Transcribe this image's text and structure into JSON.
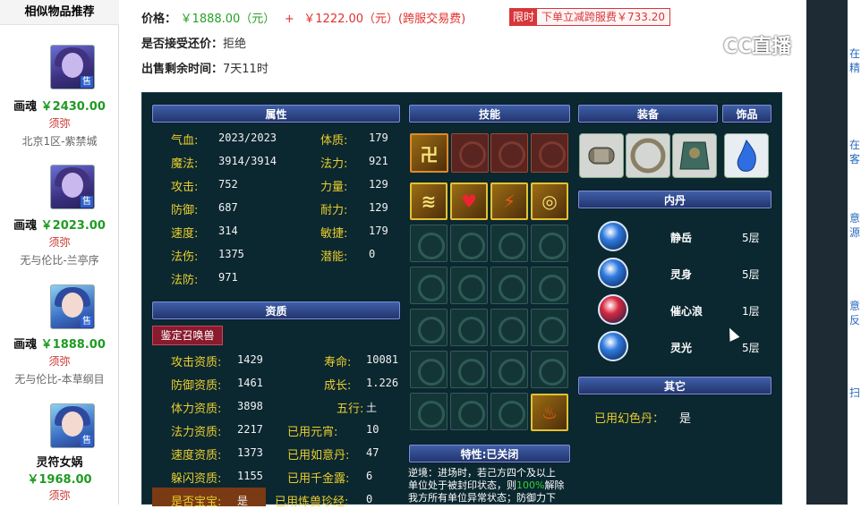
{
  "sidebar": {
    "title": "相似物品推荐",
    "items": [
      {
        "name": "画魂",
        "price": "￥2430.00",
        "server_tag": "须弥",
        "location": "北京1区-紫禁城",
        "sold_label": "售"
      },
      {
        "name": "画魂",
        "price": "￥2023.00",
        "server_tag": "须弥",
        "location": "无与伦比-兰亭序",
        "sold_label": "售"
      },
      {
        "name": "画魂",
        "price": "￥1888.00",
        "server_tag": "须弥",
        "location": "无与伦比-本草纲目",
        "sold_label": "售"
      },
      {
        "name": "灵符女娲",
        "price": "￥1968.00",
        "server_tag": "须弥",
        "location": "",
        "sold_label": "售"
      }
    ]
  },
  "header": {
    "price_label": "价格：",
    "price_value": "￥1888.00（元）",
    "plus": "+",
    "fee_value": "￥1222.00（元）(跨服交易费)",
    "limit_tag": "限时",
    "limit_text": "下单立减跨服费￥733.20",
    "bargain_label": "是否接受还价：",
    "bargain_value": "拒绝",
    "remaining_label": "出售剩余时间：",
    "remaining_value": "7天11时"
  },
  "panel": {
    "attr_header": "属性",
    "skill_header": "技能",
    "equip_header": "装备",
    "accessory_header": "饰品",
    "neidan_header": "内丹",
    "other_header": "其它",
    "aptitude_header": "资质",
    "trait_header": "特性:已关闭",
    "identify_button": "鉴定召唤兽",
    "attrs_left": [
      {
        "label": "气血:",
        "value": "2023/2023"
      },
      {
        "label": "魔法:",
        "value": "3914/3914"
      },
      {
        "label": "攻击:",
        "value": "752"
      },
      {
        "label": "防御:",
        "value": "687"
      },
      {
        "label": "速度:",
        "value": "314"
      },
      {
        "label": "法伤:",
        "value": "1375"
      },
      {
        "label": "法防:",
        "value": "971"
      }
    ],
    "attrs_right": [
      {
        "label": "体质:",
        "value": "179"
      },
      {
        "label": "法力:",
        "value": "921"
      },
      {
        "label": "力量:",
        "value": "129"
      },
      {
        "label": "耐力:",
        "value": "129"
      },
      {
        "label": "敏捷:",
        "value": "179"
      },
      {
        "label": "潜能:",
        "value": "0"
      }
    ],
    "apt_left": [
      {
        "label": "攻击资质:",
        "value": "1429"
      },
      {
        "label": "防御资质:",
        "value": "1461"
      },
      {
        "label": "体力资质:",
        "value": "3898"
      },
      {
        "label": "法力资质:",
        "value": "2217"
      },
      {
        "label": "速度资质:",
        "value": "1373"
      },
      {
        "label": "躲闪资质:",
        "value": "1155"
      },
      {
        "label": "是否宝宝:",
        "value": "是"
      }
    ],
    "apt_right": [
      {
        "label": "寿命:",
        "value": "10081"
      },
      {
        "label": "成长:",
        "value": "1.226"
      },
      {
        "label": "五行:",
        "value": "土"
      },
      {
        "label": "已用元宵:",
        "value": "10"
      },
      {
        "label": "已用如意丹:",
        "value": "47"
      },
      {
        "label": "已用千金露:",
        "value": "6"
      },
      {
        "label": "已用炼兽珍经:",
        "value": "0"
      }
    ],
    "neidan": [
      {
        "name": "静岳",
        "level": "5层",
        "color": "#2f7be0"
      },
      {
        "name": "灵身",
        "level": "5层",
        "color": "#2f7be0"
      },
      {
        "name": "催心浪",
        "level": "1层",
        "color": "#d8283e"
      },
      {
        "name": "灵光",
        "level": "5层",
        "color": "#2f7be0"
      }
    ],
    "other_label": "已用幻色丹：",
    "other_value": "是",
    "trait_text_1": "逆境：进场时，若己方四个及以上",
    "trait_text_2a": "单位处于被封印状态，则",
    "trait_text_2b": "100%",
    "trait_text_2c": "解除",
    "trait_text_3": "我方所有单位异常状态；防御力下"
  },
  "overlay": {
    "brand": "CC直播"
  },
  "right_cards": [
    "在精",
    "在客",
    "意源",
    "意反",
    "扫"
  ]
}
